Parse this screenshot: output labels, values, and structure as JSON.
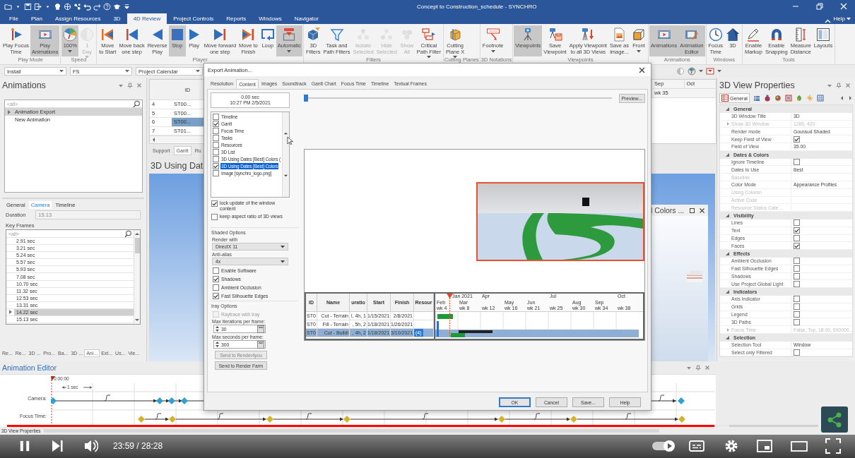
{
  "title_bar": {
    "title": "Concept to Construction_schedule - SYNCHRO"
  },
  "ribbon": {
    "tabs": [
      {
        "label": "File",
        "selected": false
      },
      {
        "label": "Plan",
        "selected": false
      },
      {
        "label": "Assign Resources",
        "selected": false
      },
      {
        "label": "3D",
        "selected": false
      },
      {
        "label": "4D Review",
        "selected": true
      },
      {
        "label": "Project Controls",
        "selected": false
      },
      {
        "label": "Reports",
        "selected": false
      },
      {
        "label": "Windows",
        "selected": false
      },
      {
        "label": "Navigator",
        "selected": false
      }
    ],
    "help": "Help",
    "groups": [
      {
        "label": "Play Mode",
        "buttons": [
          {
            "kind": "playfocus",
            "label": "Play Focus\nTime",
            "active": false,
            "disabled": false,
            "dropdown": false
          },
          {
            "kind": "film",
            "label": "Play\nAnimations",
            "active": true,
            "disabled": false,
            "dropdown": false
          }
        ]
      },
      {
        "label": "Speed",
        "buttons": [
          {
            "kind": "gauge",
            "label": "100%",
            "active": true,
            "disabled": false,
            "dropdown": true
          },
          {
            "kind": "halfmoon",
            "label": "1\nDay",
            "active": false,
            "disabled": true,
            "dropdown": true
          }
        ]
      },
      {
        "label": "Player",
        "buttons": [
          {
            "kind": "tostart",
            "label": "Move\nto Start",
            "active": false,
            "disabled": false,
            "dropdown": false
          },
          {
            "kind": "stepback",
            "label": "Move back\none step",
            "active": false,
            "disabled": false,
            "dropdown": false
          },
          {
            "kind": "reverse",
            "label": "Reverse\nPlay",
            "active": false,
            "disabled": false,
            "dropdown": false
          },
          {
            "kind": "stop",
            "label": "Stop",
            "active": true,
            "disabled": false,
            "dropdown": false
          },
          {
            "kind": "play",
            "label": "Play",
            "active": false,
            "disabled": false,
            "dropdown": false
          },
          {
            "kind": "stepfwd",
            "label": "Move forward\none step",
            "active": false,
            "disabled": false,
            "dropdown": false
          },
          {
            "kind": "tofinish",
            "label": "Move to\nFinish",
            "active": false,
            "disabled": false,
            "dropdown": false
          },
          {
            "kind": "loop",
            "label": "Loop",
            "active": false,
            "disabled": false,
            "dropdown": false
          },
          {
            "kind": "auto",
            "label": "Automatic",
            "active": true,
            "disabled": false,
            "dropdown": true
          }
        ]
      },
      {
        "label": "Filters",
        "buttons": [
          {
            "kind": "filter3d",
            "label": "3D\nFilters",
            "active": false,
            "disabled": false,
            "dropdown": false
          },
          {
            "kind": "funnel",
            "label": "Task and\nPath Filters",
            "active": false,
            "disabled": false,
            "dropdown": false
          },
          {
            "kind": "isolate",
            "label": "Isolate\nSelected",
            "active": false,
            "disabled": true,
            "dropdown": false
          },
          {
            "kind": "hide",
            "label": "Hide\nSelected",
            "active": false,
            "disabled": true,
            "dropdown": false
          },
          {
            "kind": "showall",
            "label": "Show\nAll",
            "active": false,
            "disabled": true,
            "dropdown": false
          },
          {
            "kind": "critical",
            "label": "Critical\nPath Filter",
            "active": false,
            "disabled": false,
            "dropdown": true
          }
        ]
      },
      {
        "label": "Cutting Planes",
        "buttons": [
          {
            "kind": "cutplane",
            "label": "Cutting\nPlane X",
            "active": false,
            "disabled": false,
            "dropdown": true
          }
        ]
      },
      {
        "label": "3D Notations",
        "buttons": [
          {
            "kind": "footnote",
            "label": "Footnote",
            "active": false,
            "disabled": false,
            "dropdown": true
          }
        ]
      },
      {
        "label": "Viewpoints",
        "buttons": [
          {
            "kind": "tripod",
            "label": "Viewpoints",
            "active": true,
            "disabled": false,
            "dropdown": false
          },
          {
            "kind": "savevp",
            "label": "Save\nViewpoint",
            "active": false,
            "disabled": false,
            "dropdown": false
          },
          {
            "kind": "applyvp",
            "label": "Apply Viewpoint\nto all 3D Views",
            "active": false,
            "disabled": false,
            "dropdown": false
          },
          {
            "kind": "saveimage",
            "label": "Save as\nimage...",
            "active": false,
            "disabled": false,
            "dropdown": false
          },
          {
            "kind": "front",
            "label": "Front",
            "active": false,
            "disabled": false,
            "dropdown": true
          }
        ]
      },
      {
        "label": "Animations",
        "buttons": [
          {
            "kind": "film",
            "label": "Animations",
            "active": true,
            "disabled": false,
            "dropdown": false
          },
          {
            "kind": "filmedit",
            "label": "Animation\nEditor",
            "active": true,
            "disabled": false,
            "dropdown": false
          }
        ]
      },
      {
        "label": "Windows",
        "buttons": [
          {
            "kind": "clock",
            "label": "Focus\nTime",
            "active": false,
            "disabled": false,
            "dropdown": false
          },
          {
            "kind": "house",
            "label": "3D",
            "active": false,
            "disabled": false,
            "dropdown": false
          }
        ]
      },
      {
        "label": "Tools",
        "buttons": [
          {
            "kind": "pencil",
            "label": "Enable\nMarkup",
            "active": false,
            "disabled": false,
            "dropdown": false
          },
          {
            "kind": "magnet",
            "label": "Enable\nSnapping",
            "active": false,
            "disabled": false,
            "dropdown": false
          },
          {
            "kind": "ruler",
            "label": "Measure\nDistance",
            "active": false,
            "disabled": false,
            "dropdown": false
          },
          {
            "kind": "layout",
            "label": "Layouts",
            "active": false,
            "disabled": false,
            "dropdown": false
          }
        ]
      }
    ]
  },
  "toolbar": {
    "selects": [
      {
        "value": "Install"
      },
      {
        "value": "FS"
      },
      {
        "value": "Project Calendar"
      }
    ]
  },
  "animations_panel": {
    "title": "Animations",
    "filter": {
      "placeholder": "<all>"
    },
    "items": [
      {
        "label": "Animation Export",
        "selected": true,
        "expandable": true
      },
      {
        "label": "New Animation",
        "selected": false,
        "expandable": false
      }
    ],
    "tabs": [
      {
        "label": "General",
        "selected": false
      },
      {
        "label": "Camera",
        "selected": true
      },
      {
        "label": "Timeline",
        "selected": false
      }
    ],
    "duration_label": "Duration",
    "duration": "15.13",
    "keyframes_label": "Key Frames",
    "keyframes_filter": {
      "placeholder": "<all>"
    },
    "keyframes": [
      {
        "label": "2.91 sec",
        "selected": false
      },
      {
        "label": "3.21 sec",
        "selected": false
      },
      {
        "label": "5.24 sec",
        "selected": false
      },
      {
        "label": "5.57 sec",
        "selected": false
      },
      {
        "label": "5.93 sec",
        "selected": false
      },
      {
        "label": "7.08 sec",
        "selected": false
      },
      {
        "label": "10.70 sec",
        "selected": false
      },
      {
        "label": "11.32 sec",
        "selected": false
      },
      {
        "label": "12.53 sec",
        "selected": false
      },
      {
        "label": "13.31 sec",
        "selected": false
      },
      {
        "label": "14.22 sec",
        "selected": true
      },
      {
        "label": "15.13 sec",
        "selected": false
      }
    ],
    "bottom_tabs": [
      {
        "label": "Re...",
        "selected": false
      },
      {
        "label": "Re...",
        "selected": false
      },
      {
        "label": "3D ...",
        "selected": false
      },
      {
        "label": "Pro...",
        "selected": false
      },
      {
        "label": "Ba...",
        "selected": false
      },
      {
        "label": "3D ...",
        "selected": false
      },
      {
        "label": "Ani...",
        "selected": true
      },
      {
        "label": "Ext...",
        "selected": false
      },
      {
        "label": "Us...",
        "selected": false
      },
      {
        "label": "Vie...",
        "selected": false
      }
    ]
  },
  "task_grid": {
    "column": "ID",
    "rows": [
      {
        "number": "4",
        "id": "ST00...",
        "selected": false
      },
      {
        "number": "5",
        "id": "ST00...",
        "selected": false
      },
      {
        "number": "6",
        "id": "ST00...",
        "selected": true
      },
      {
        "number": "7",
        "id": "ST01...",
        "selected": false
      }
    ],
    "tabs": [
      {
        "label": "Support",
        "selected": false
      },
      {
        "label": "Gantt",
        "selected": true
      },
      {
        "label": "Ru",
        "selected": false
      }
    ]
  },
  "gantt_strip": {
    "months": [
      "Sep",
      "Oct"
    ],
    "weeks": [
      "wk 35"
    ]
  },
  "view_title": "3D Using Dat",
  "floating_view": {
    "title": "l Colors ..."
  },
  "properties_panel": {
    "title": "3D View Properties",
    "tab": {
      "label": "General",
      "selected": true
    },
    "sections": [
      {
        "title": "General",
        "expanded": true,
        "rows": [
          {
            "kind": "text",
            "label": "3D Window Title",
            "value": "3D",
            "disabled": false
          },
          {
            "kind": "group",
            "label": "Show 3D Window",
            "value": "1266, 420",
            "disabled": true
          },
          {
            "kind": "text",
            "label": "Render mode",
            "value": "Gouraud Shaded",
            "disabled": false
          },
          {
            "kind": "check",
            "label": "Keep Field of View",
            "checked": true,
            "disabled": false
          },
          {
            "kind": "text",
            "label": "Field of View",
            "value": "35.00",
            "disabled": false
          }
        ]
      },
      {
        "title": "Dates & Colors",
        "expanded": true,
        "rows": [
          {
            "kind": "check",
            "label": "Ignore Timeline",
            "checked": false,
            "disabled": false
          },
          {
            "kind": "text",
            "label": "Dates to Use",
            "value": "Best",
            "disabled": false
          },
          {
            "kind": "empty",
            "label": "Baseline",
            "disabled": true
          },
          {
            "kind": "text",
            "label": "Color Mode",
            "value": "Appearance Profiles",
            "disabled": false
          },
          {
            "kind": "empty",
            "label": "Using Column",
            "disabled": true
          },
          {
            "kind": "empty",
            "label": "Active Code",
            "disabled": true
          },
          {
            "kind": "empty",
            "label": "Resource Status Cate...",
            "disabled": true
          }
        ]
      },
      {
        "title": "Visibility",
        "expanded": true,
        "rows": [
          {
            "kind": "check",
            "label": "Lines",
            "checked": false,
            "disabled": false
          },
          {
            "kind": "check",
            "label": "Text",
            "checked": true,
            "disabled": false
          },
          {
            "kind": "check",
            "label": "Edges",
            "checked": false,
            "disabled": false
          },
          {
            "kind": "check",
            "label": "Faces",
            "checked": true,
            "disabled": false
          }
        ]
      },
      {
        "title": "Effects",
        "expanded": true,
        "rows": [
          {
            "kind": "check",
            "label": "Ambient Occlusion",
            "checked": false,
            "disabled": false
          },
          {
            "kind": "check",
            "label": "Fast Silhouette Edges",
            "checked": false,
            "disabled": false
          },
          {
            "kind": "check",
            "label": "Shadows",
            "checked": false,
            "disabled": false
          },
          {
            "kind": "check",
            "label": "Use Project Global Light",
            "checked": false,
            "disabled": false
          }
        ]
      },
      {
        "title": "Indicators",
        "expanded": true,
        "rows": [
          {
            "kind": "check",
            "label": "Axis Indicator",
            "checked": false,
            "disabled": false
          },
          {
            "kind": "check",
            "label": "Grids",
            "checked": false,
            "disabled": false
          },
          {
            "kind": "check",
            "label": "Legend",
            "checked": false,
            "disabled": false
          },
          {
            "kind": "check",
            "label": "3D Paths",
            "checked": false,
            "disabled": false
          },
          {
            "kind": "group",
            "label": "Focus Time",
            "value": "False, Top, 18.00, 000000...",
            "disabled": true
          }
        ]
      },
      {
        "title": "Selection",
        "expanded": true,
        "rows": [
          {
            "kind": "text",
            "label": "Selection Tool",
            "value": "Window",
            "disabled": false
          },
          {
            "kind": "check",
            "label": "Select only Filtered",
            "checked": false,
            "disabled": false
          }
        ]
      }
    ]
  },
  "export_dialog": {
    "title": "Export Animation...",
    "tabs": [
      {
        "label": "Resolution",
        "selected": false
      },
      {
        "label": "Content",
        "selected": true
      },
      {
        "label": "Images",
        "selected": false
      },
      {
        "label": "Soundtrack",
        "selected": false
      },
      {
        "label": "Gantt Chart",
        "selected": false
      },
      {
        "label": "Focus Time",
        "selected": false
      },
      {
        "label": "Timeline",
        "selected": false
      },
      {
        "label": "Textual Frames",
        "selected": false
      }
    ],
    "time": {
      "seconds": "0.00 sec",
      "date": "10:27 PM 2/5/2021"
    },
    "content_items": [
      {
        "label": "Timeline",
        "checked": false,
        "selected": false
      },
      {
        "label": "Gantt",
        "checked": true,
        "selected": false
      },
      {
        "label": "Focus Time",
        "checked": false,
        "selected": false
      },
      {
        "label": "Tasks",
        "checked": false,
        "selected": false
      },
      {
        "label": "Resources",
        "checked": false,
        "selected": false
      },
      {
        "label": "3D List",
        "checked": false,
        "selected": false
      },
      {
        "label": "3D Using Dates [Best] Colors (",
        "checked": false,
        "selected": false
      },
      {
        "label": "3D Using Dates [Best] Colors",
        "checked": true,
        "selected": true
      },
      {
        "label": "Image [synchro_logo.png]",
        "checked": false,
        "selected": false
      }
    ],
    "window_options": [
      {
        "label": "lock update of the window content",
        "checked": true
      },
      {
        "label": "keep aspect ratio of 3D views",
        "checked": false
      }
    ],
    "shaded_options": {
      "title": "Shaded Options",
      "render_label": "Render with",
      "render_value": "DirectX 11",
      "antialias_label": "Anti-alias",
      "antialias_value": "4x",
      "checks": [
        {
          "label": "Enable Software",
          "checked": false
        },
        {
          "label": "Shadows",
          "checked": true
        },
        {
          "label": "Ambient Occlusion",
          "checked": false
        },
        {
          "label": "Fast Silhouette Edges",
          "checked": true
        }
      ]
    },
    "iray_options": {
      "title": "Iray Options",
      "raytrace": {
        "label": "Raytrace with Iray",
        "checked": false,
        "disabled": true
      },
      "iterations_label": "Max iterations per frame:",
      "iterations": "30",
      "seconds_label": "Max seconds per frame:",
      "seconds": "300",
      "buttons": [
        {
          "label": "Send to Render4you",
          "disabled": true
        },
        {
          "label": "Send to Render Farm",
          "disabled": false
        }
      ]
    },
    "timeline_slider": {
      "level": 0
    },
    "preview_button": "Preview...",
    "gantt_preview": {
      "columns": [
        "ID",
        "Name",
        "uratio",
        "Start",
        "Finish",
        "Resour"
      ],
      "rows": [
        {
          "id": "ST0",
          "name": "Cut - Terrain",
          "duration": "l, 4h, 1",
          "start": "1/15/2021",
          "finish": "2/8/2021",
          "selected": false
        },
        {
          "id": "ST0",
          "name": "Fill - Terrain",
          "duration": ", 5h, 2",
          "start": "1/18/2021",
          "finish": "1/26/2021",
          "selected": false
        },
        {
          "id": "ST0",
          "name": "Cut - Buildi",
          "duration": ", 4h, 2",
          "start": "1/18/2021",
          "finish": "3/10/2021",
          "resource": "(4)",
          "selected": true
        }
      ],
      "years": [
        "Jan 2021",
        "Apr",
        "Jul",
        "Oct"
      ],
      "months": [
        "Feb",
        "Mar",
        "May",
        "Jun",
        "Aug",
        "Sep"
      ],
      "weeks": [
        "wk 4",
        "wk 8",
        "wk 12",
        "wk 16",
        "wk 21",
        "wk 25",
        "wk 30",
        "wk 34",
        "wk 38"
      ]
    },
    "buttons": [
      {
        "label": "OK",
        "default": true
      },
      {
        "label": "Cancel",
        "default": false
      },
      {
        "label": "Save...",
        "default": false
      },
      {
        "label": "Help",
        "default": false
      }
    ]
  },
  "animation_editor": {
    "title": "Animation Editor",
    "start_time": "0:00:00",
    "scale": "1 sec",
    "tracks": [
      {
        "label": "Camera:",
        "color": "#2f9fd4"
      },
      {
        "label": "Focus Time:",
        "color": "#d6b22c"
      }
    ],
    "tab": "3D View Properties"
  },
  "player": {
    "progress": {
      "level": 0.872
    },
    "time": "23:59 / 28:28",
    "autoplay": {
      "on": true
    }
  }
}
